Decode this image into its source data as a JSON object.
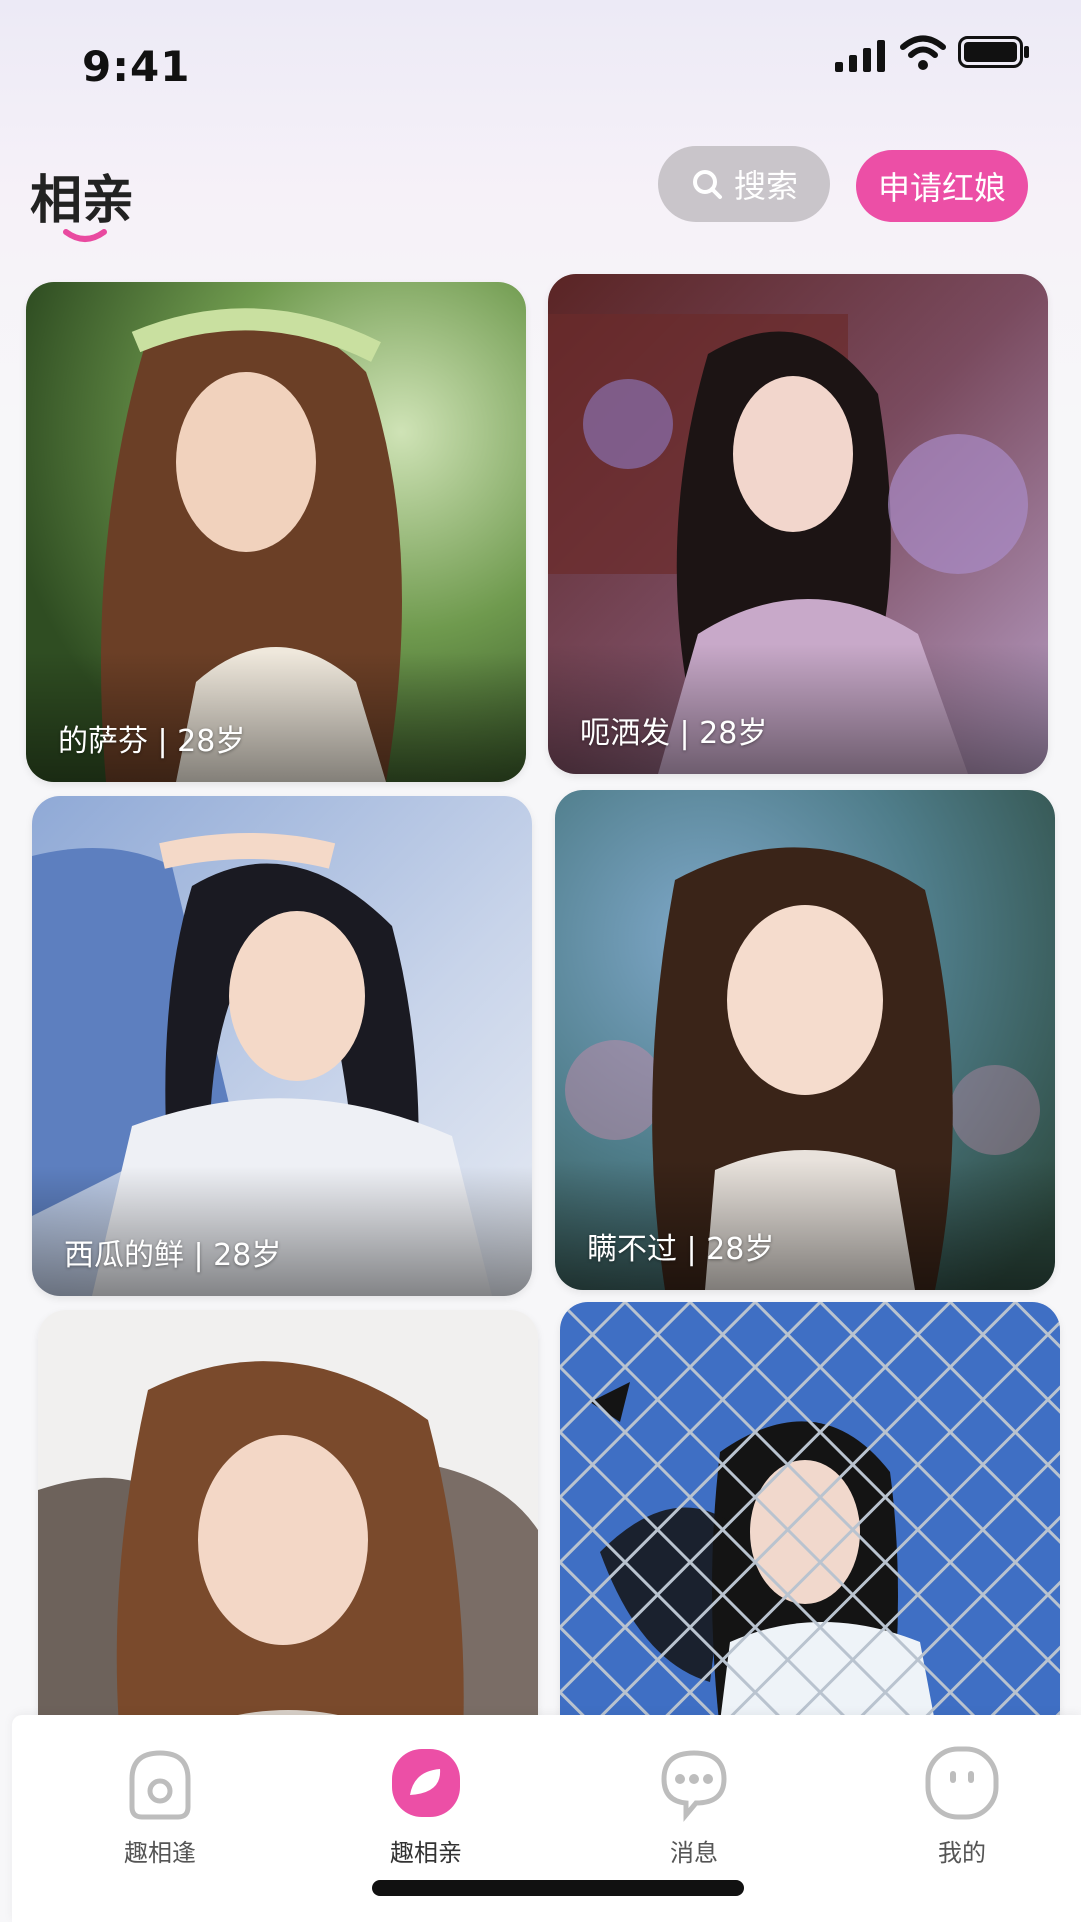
{
  "status_bar": {
    "time": "9:41"
  },
  "header": {
    "title": "相亲",
    "search_label": "搜索",
    "matchmaker_label": "申请红娘"
  },
  "profiles": [
    {
      "caption": "的萨芬 | 28岁"
    },
    {
      "caption": "呃洒发 | 28岁"
    },
    {
      "caption": "西瓜的鲜 | 28岁"
    },
    {
      "caption": "瞒不过 | 28岁"
    },
    {
      "caption": ""
    },
    {
      "caption": ""
    }
  ],
  "tabbar": {
    "items": [
      {
        "label": "趣相逢",
        "icon": "home-icon"
      },
      {
        "label": "趣相亲",
        "icon": "dating-icon"
      },
      {
        "label": "消息",
        "icon": "message-icon"
      },
      {
        "label": "我的",
        "icon": "profile-icon"
      }
    ]
  },
  "colors": {
    "accent": "#ec4fa6",
    "search_bg": "#c9c5ca",
    "background": "#f7f7f9"
  }
}
